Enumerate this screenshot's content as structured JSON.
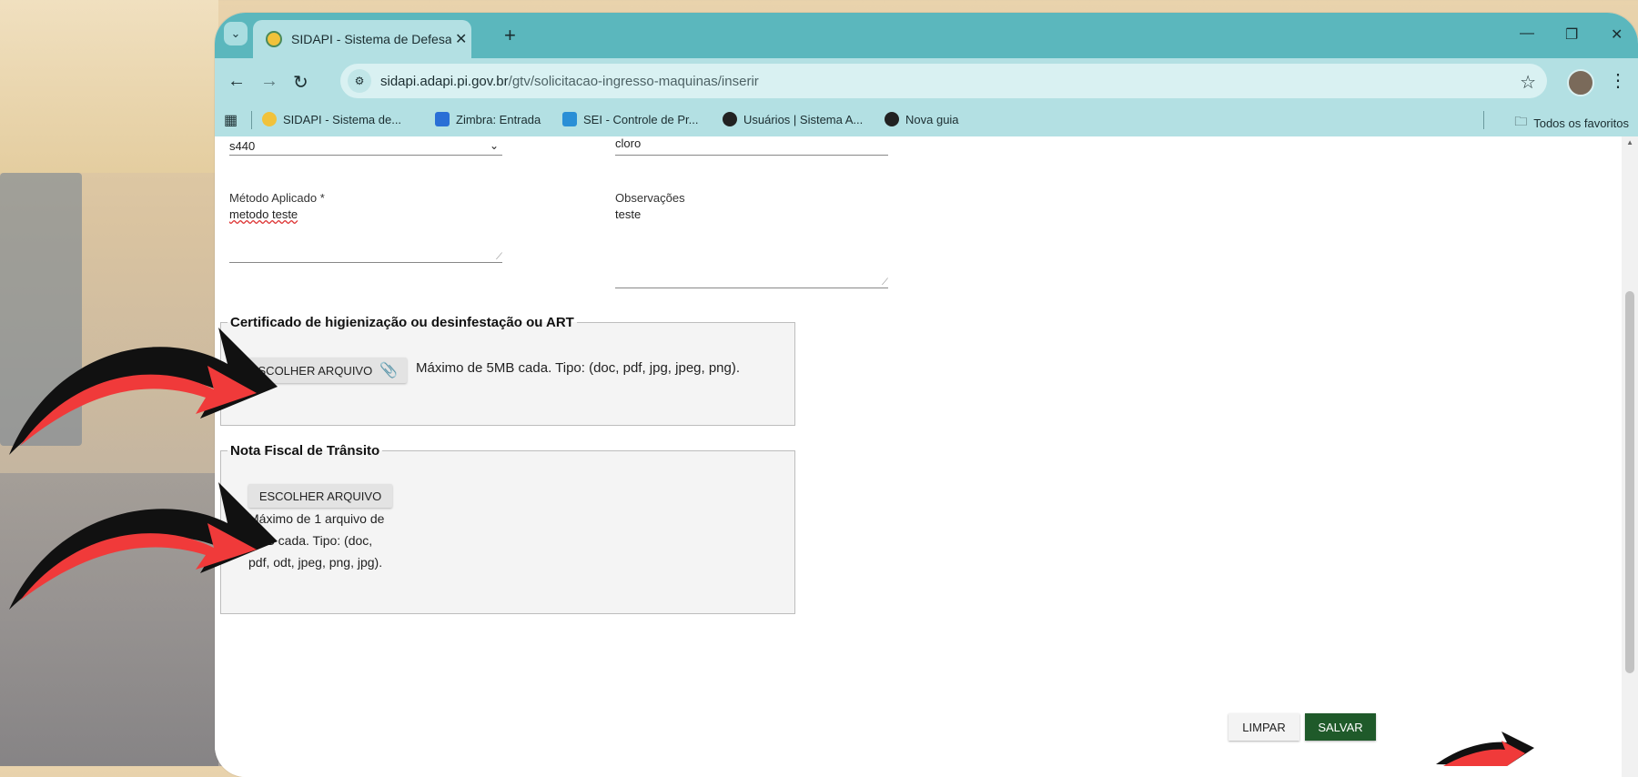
{
  "browser": {
    "tab_title": "SIDAPI - Sistema de Defesa Agr",
    "url_domain": "sidapi.adapi.pi.gov.br",
    "url_path": "/gtv/solicitacao-ingresso-maquinas/inserir",
    "bookmarks": [
      {
        "label": "SIDAPI - Sistema de...",
        "icon": "sidapi-icon",
        "color": "#f1c23b"
      },
      {
        "label": "Zimbra: Entrada",
        "icon": "zimbra-icon",
        "color": "#2a6fd6"
      },
      {
        "label": "SEI - Controle de Pr...",
        "icon": "sei-icon",
        "color": "#2a8fd6"
      },
      {
        "label": "Usuários | Sistema A...",
        "icon": "globe-icon",
        "color": "#222222"
      },
      {
        "label": "Nova guia",
        "icon": "globe-icon",
        "color": "#222222"
      }
    ],
    "all_bookmarks": "Todos os favoritos"
  },
  "form": {
    "select_value": "s440",
    "product_value": "cloro",
    "method_label": "Método Aplicado *",
    "method_value": "metodo teste",
    "observations_label": "Observações",
    "observations_value": "teste",
    "certificate": {
      "legend": "Certificado de higienização ou desinfestação ou ART",
      "button": "ESCOLHER ARQUIVO",
      "hint": "Máximo de 5MB cada. Tipo: (doc, pdf, jpg, jpeg, png)."
    },
    "invoice": {
      "legend": "Nota Fiscal de Trânsito",
      "button": "ESCOLHER ARQUIVO",
      "hint_line1": " Máximo de 1 arquivo de",
      "hint_line2": "2MB cada. Tipo: (doc,",
      "hint_line3": "pdf, odt, jpeg, png, jpg)."
    },
    "clear_button": "LIMPAR",
    "save_button": "SALVAR"
  },
  "colors": {
    "tabstrip": "#5bb7bd",
    "toolbar": "#b3e0e3",
    "save": "#1f5a2a",
    "arrow_red": "#f03a3a"
  }
}
